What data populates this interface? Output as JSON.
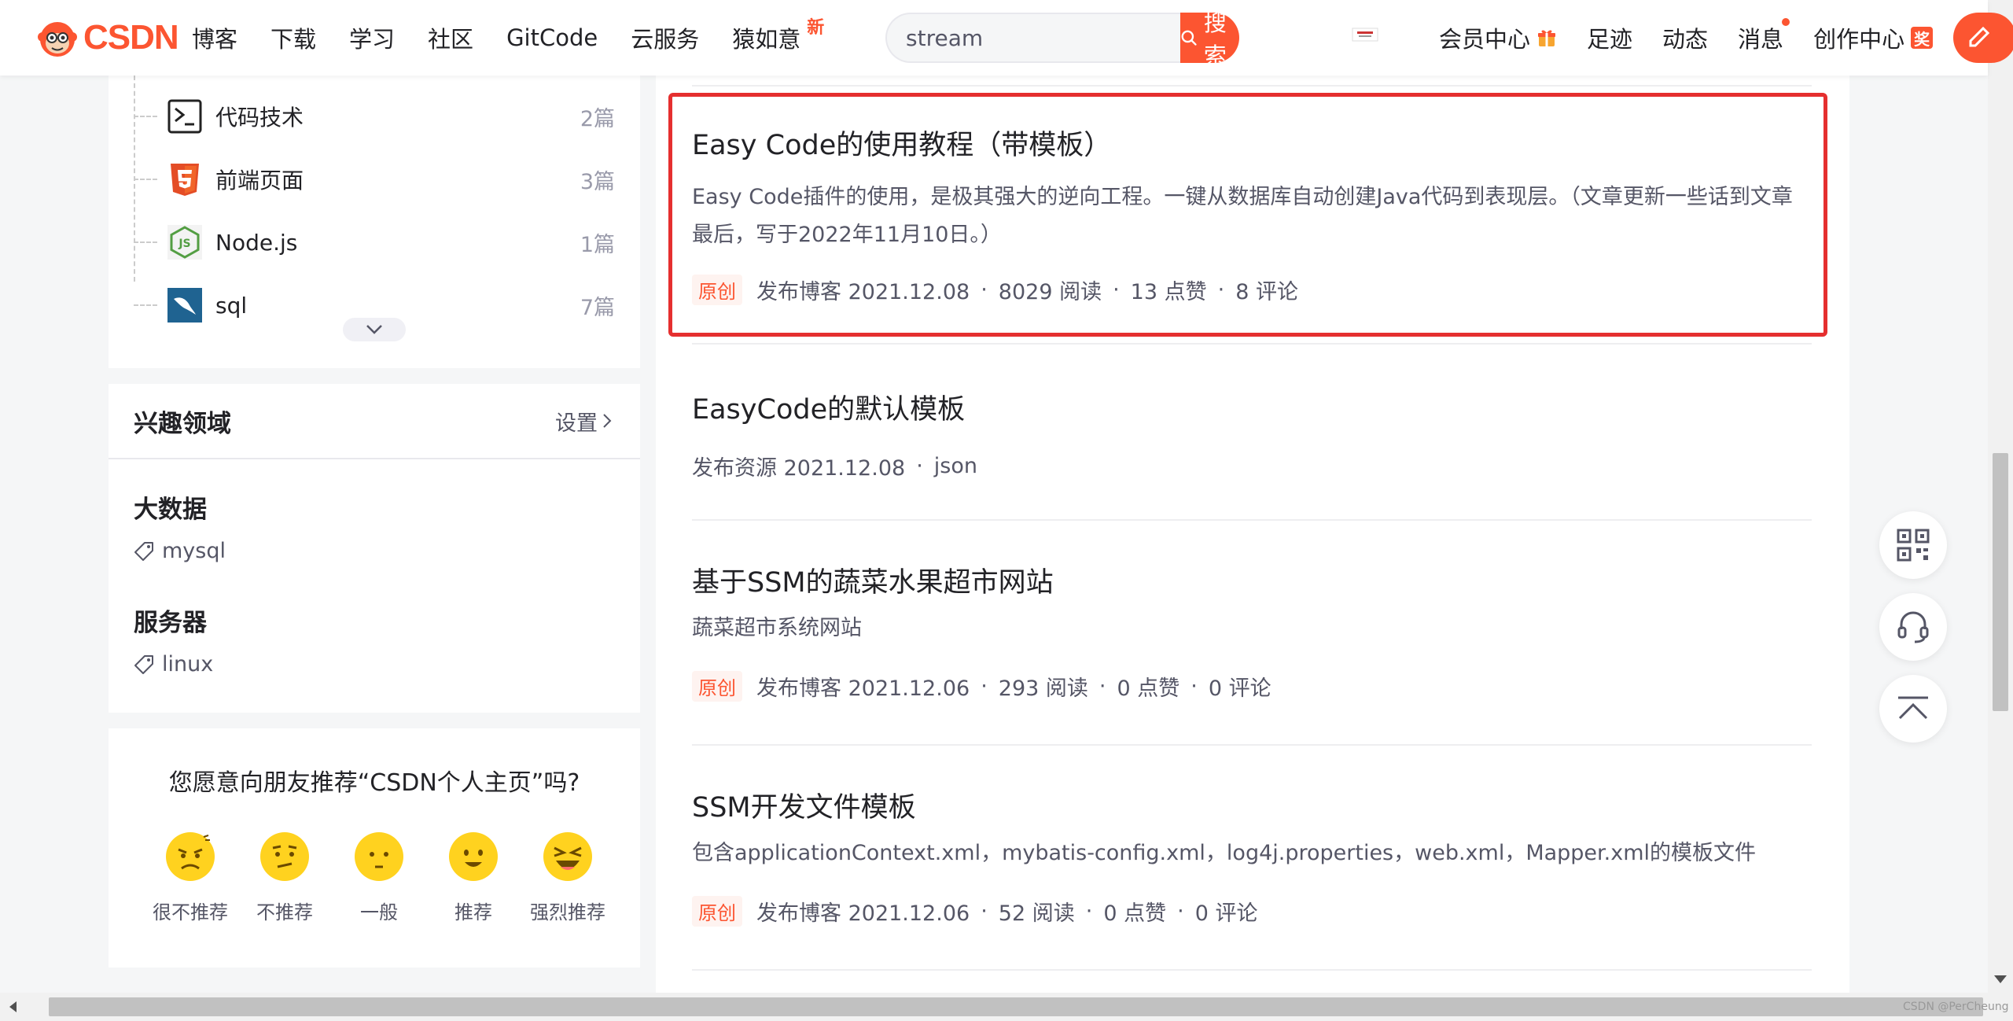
{
  "header": {
    "logo_text": "CSDN",
    "nav": [
      {
        "label": "博客"
      },
      {
        "label": "下载"
      },
      {
        "label": "学习"
      },
      {
        "label": "社区"
      },
      {
        "label": "GitCode"
      },
      {
        "label": "云服务"
      },
      {
        "label": "猿如意",
        "badge": "新"
      }
    ],
    "search": {
      "value": "stream",
      "button_label": "搜索"
    },
    "right_nav": [
      {
        "label": "会员中心"
      },
      {
        "label": "足迹"
      },
      {
        "label": "动态"
      },
      {
        "label": "消息"
      },
      {
        "label": "创作中心",
        "badge": "奖"
      }
    ],
    "accent_color": "#fc5531"
  },
  "sidebar": {
    "categories": [
      {
        "name": "代码技术",
        "count": "2篇",
        "icon": "terminal-icon"
      },
      {
        "name": "前端页面",
        "count": "3篇",
        "icon": "html5-icon"
      },
      {
        "name": "Node.js",
        "count": "1篇",
        "icon": "nodejs-icon"
      },
      {
        "name": "sql",
        "count": "7篇",
        "icon": "mysql-icon"
      }
    ],
    "interest": {
      "title": "兴趣领域",
      "setting_label": "设置",
      "groups": [
        {
          "title": "大数据",
          "tag": "mysql"
        },
        {
          "title": "服务器",
          "tag": "linux"
        }
      ]
    },
    "recommend": {
      "question": "您愿意向朋友推荐“CSDN个人主页”吗?",
      "options": [
        "很不推荐",
        "不推荐",
        "一般",
        "推荐",
        "强烈推荐"
      ]
    }
  },
  "articles": [
    {
      "title": "Easy Code的使用教程（带模板）",
      "desc": "Easy Code插件的使用，是极其强大的逆向工程。一键从数据库自动创建Java代码到表现层。（文章更新一些话到文章最后，写于2022年11月10日。）",
      "tag": "原创",
      "meta": [
        "发布博客 2021.12.08",
        "8029 阅读",
        "13 点赞",
        "8 评论"
      ]
    },
    {
      "title": "EasyCode的默认模板",
      "desc": "",
      "tag": "",
      "meta": [
        "发布资源 2021.12.08",
        "json"
      ]
    },
    {
      "title": "基于SSM的蔬菜水果超市网站",
      "desc": "蔬菜超市系统网站",
      "tag": "原创",
      "meta": [
        "发布博客 2021.12.06",
        "293 阅读",
        "0 点赞",
        "0 评论"
      ]
    },
    {
      "title": "SSM开发文件模板",
      "desc": "包含applicationContext.xml，mybatis-config.xml，log4j.properties，web.xml，Mapper.xml的模板文件",
      "tag": "原创",
      "meta": [
        "发布博客 2021.12.06",
        "52 阅读",
        "0 点赞",
        "0 评论"
      ]
    }
  ],
  "tools": [
    "qrcode-icon",
    "customer-service-icon",
    "back-to-top-icon"
  ],
  "watermark": "CSDN @PerCheung"
}
